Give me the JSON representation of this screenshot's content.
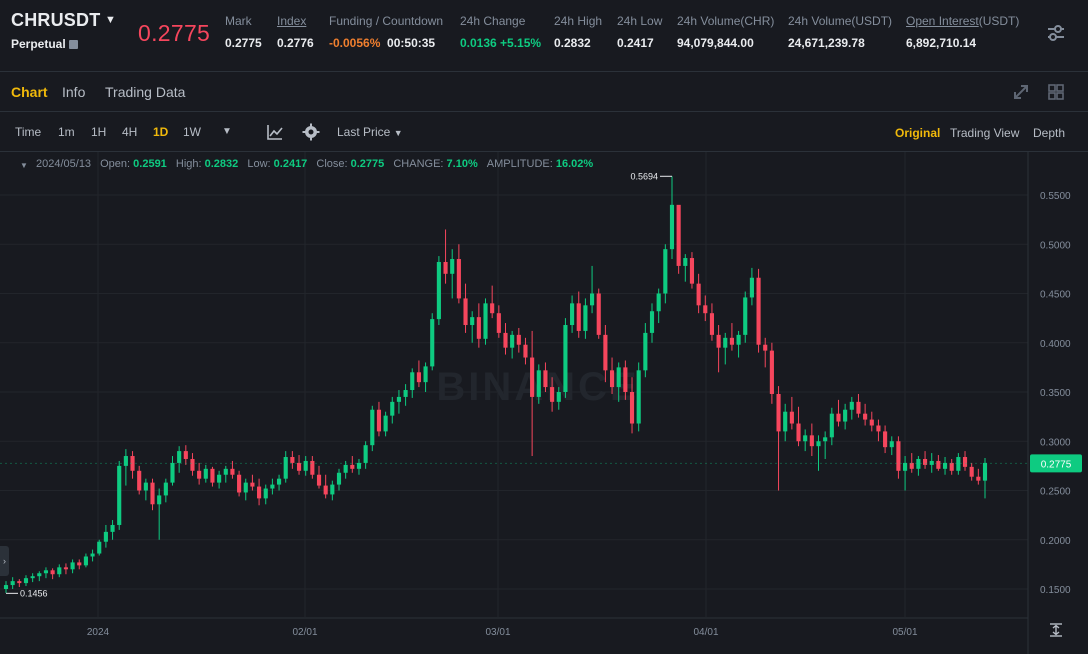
{
  "header": {
    "symbol": "CHRUSDT",
    "contract_type": "Perpetual",
    "last_price": "0.2775",
    "stats": [
      {
        "label": "Mark",
        "value": "0.2775",
        "underline": false
      },
      {
        "label": "Index",
        "value": "0.2776",
        "underline": true
      },
      {
        "label": "Funding / Countdown",
        "value": "-0.0056%",
        "value2": "00:50:35",
        "underline": false
      },
      {
        "label": "24h Change",
        "value": "0.0136 +5.15%",
        "underline": false
      },
      {
        "label": "24h High",
        "value": "0.2832",
        "underline": false
      },
      {
        "label": "24h Low",
        "value": "0.2417",
        "underline": false
      },
      {
        "label": "24h Volume(CHR)",
        "value": "94,079,844.00",
        "underline": false
      },
      {
        "label": "24h Volume(USDT)",
        "value": "24,671,239.78",
        "underline": false
      },
      {
        "label_underlined": "Open Interest",
        "label_suffix": "(USDT)",
        "value": "6,892,710.14"
      }
    ],
    "settings_icon": "sliders-icon"
  },
  "tabs": [
    "Chart",
    "Info",
    "Trading Data"
  ],
  "active_tab": "Chart",
  "toolbar": {
    "intervals": [
      "Time",
      "1m",
      "1H",
      "4H",
      "1D",
      "1W"
    ],
    "active_interval": "1D",
    "price_type": "Last Price",
    "views": [
      "Original",
      "Trading View",
      "Depth"
    ],
    "active_view": "Original"
  },
  "ohlc": {
    "date": "2024/05/13",
    "open_label": "Open:",
    "open": "0.2591",
    "high_label": "High:",
    "high": "0.2832",
    "low_label": "Low:",
    "low": "0.2417",
    "close_label": "Close:",
    "close": "0.2775",
    "change_label": "CHANGE:",
    "change": "7.10%",
    "amplitude_label": "AMPLITUDE:",
    "amplitude": "16.02%"
  },
  "colors": {
    "up": "#0ecb81",
    "down": "#f6465d",
    "accent": "#f0b90b",
    "bg": "#181a20"
  },
  "chart_data": {
    "type": "candlestick",
    "watermark": "BINANCE",
    "y_ticks": [
      "0.5500",
      "0.5000",
      "0.4500",
      "0.4000",
      "0.3500",
      "0.3000",
      "0.2500",
      "0.2000",
      "0.1500"
    ],
    "y_tick_values": [
      0.55,
      0.5,
      0.45,
      0.4,
      0.35,
      0.3,
      0.25,
      0.2,
      0.15
    ],
    "x_ticks": [
      "2024",
      "02/01",
      "03/01",
      "04/01",
      "05/01"
    ],
    "ylim": [
      0.11,
      0.59
    ],
    "current_price": "0.2775",
    "high_marker": "0.5694",
    "low_marker": "0.1456",
    "grid": true,
    "ohlc": [
      [
        0.15,
        0.158,
        0.146,
        0.154
      ],
      [
        0.154,
        0.162,
        0.15,
        0.158
      ],
      [
        0.158,
        0.16,
        0.152,
        0.156
      ],
      [
        0.156,
        0.164,
        0.153,
        0.161
      ],
      [
        0.161,
        0.166,
        0.157,
        0.163
      ],
      [
        0.163,
        0.168,
        0.158,
        0.166
      ],
      [
        0.166,
        0.172,
        0.161,
        0.169
      ],
      [
        0.169,
        0.171,
        0.16,
        0.165
      ],
      [
        0.165,
        0.175,
        0.162,
        0.172
      ],
      [
        0.172,
        0.176,
        0.165,
        0.17
      ],
      [
        0.17,
        0.18,
        0.166,
        0.177
      ],
      [
        0.177,
        0.18,
        0.17,
        0.174
      ],
      [
        0.174,
        0.186,
        0.172,
        0.183
      ],
      [
        0.183,
        0.19,
        0.178,
        0.186
      ],
      [
        0.186,
        0.2,
        0.184,
        0.198
      ],
      [
        0.198,
        0.215,
        0.192,
        0.208
      ],
      [
        0.208,
        0.22,
        0.2,
        0.215
      ],
      [
        0.215,
        0.28,
        0.21,
        0.275
      ],
      [
        0.275,
        0.292,
        0.255,
        0.285
      ],
      [
        0.285,
        0.29,
        0.262,
        0.27
      ],
      [
        0.27,
        0.275,
        0.246,
        0.25
      ],
      [
        0.25,
        0.262,
        0.24,
        0.258
      ],
      [
        0.258,
        0.262,
        0.23,
        0.236
      ],
      [
        0.236,
        0.252,
        0.2,
        0.245
      ],
      [
        0.245,
        0.262,
        0.238,
        0.258
      ],
      [
        0.258,
        0.285,
        0.255,
        0.278
      ],
      [
        0.278,
        0.295,
        0.268,
        0.29
      ],
      [
        0.29,
        0.296,
        0.276,
        0.282
      ],
      [
        0.282,
        0.288,
        0.265,
        0.27
      ],
      [
        0.27,
        0.278,
        0.256,
        0.262
      ],
      [
        0.262,
        0.276,
        0.258,
        0.272
      ],
      [
        0.272,
        0.274,
        0.254,
        0.258
      ],
      [
        0.258,
        0.27,
        0.252,
        0.266
      ],
      [
        0.266,
        0.275,
        0.258,
        0.272
      ],
      [
        0.272,
        0.28,
        0.262,
        0.266
      ],
      [
        0.266,
        0.27,
        0.244,
        0.248
      ],
      [
        0.248,
        0.262,
        0.24,
        0.258
      ],
      [
        0.258,
        0.266,
        0.25,
        0.254
      ],
      [
        0.254,
        0.262,
        0.235,
        0.242
      ],
      [
        0.242,
        0.256,
        0.236,
        0.252
      ],
      [
        0.252,
        0.262,
        0.246,
        0.256
      ],
      [
        0.256,
        0.266,
        0.25,
        0.262
      ],
      [
        0.262,
        0.29,
        0.258,
        0.284
      ],
      [
        0.284,
        0.29,
        0.272,
        0.278
      ],
      [
        0.278,
        0.286,
        0.266,
        0.27
      ],
      [
        0.27,
        0.285,
        0.265,
        0.28
      ],
      [
        0.28,
        0.285,
        0.262,
        0.266
      ],
      [
        0.266,
        0.275,
        0.252,
        0.255
      ],
      [
        0.255,
        0.266,
        0.242,
        0.246
      ],
      [
        0.246,
        0.26,
        0.24,
        0.256
      ],
      [
        0.256,
        0.272,
        0.25,
        0.268
      ],
      [
        0.268,
        0.28,
        0.262,
        0.276
      ],
      [
        0.276,
        0.285,
        0.268,
        0.272
      ],
      [
        0.272,
        0.282,
        0.266,
        0.278
      ],
      [
        0.278,
        0.3,
        0.272,
        0.296
      ],
      [
        0.296,
        0.336,
        0.29,
        0.332
      ],
      [
        0.332,
        0.34,
        0.305,
        0.31
      ],
      [
        0.31,
        0.33,
        0.305,
        0.326
      ],
      [
        0.326,
        0.345,
        0.318,
        0.34
      ],
      [
        0.34,
        0.352,
        0.328,
        0.345
      ],
      [
        0.345,
        0.358,
        0.336,
        0.352
      ],
      [
        0.352,
        0.374,
        0.344,
        0.37
      ],
      [
        0.37,
        0.382,
        0.355,
        0.36
      ],
      [
        0.36,
        0.38,
        0.35,
        0.376
      ],
      [
        0.376,
        0.43,
        0.372,
        0.424
      ],
      [
        0.424,
        0.488,
        0.418,
        0.482
      ],
      [
        0.482,
        0.515,
        0.46,
        0.47
      ],
      [
        0.47,
        0.495,
        0.445,
        0.485
      ],
      [
        0.485,
        0.5,
        0.44,
        0.445
      ],
      [
        0.445,
        0.46,
        0.41,
        0.418
      ],
      [
        0.418,
        0.432,
        0.4,
        0.426
      ],
      [
        0.426,
        0.44,
        0.395,
        0.404
      ],
      [
        0.404,
        0.445,
        0.398,
        0.44
      ],
      [
        0.44,
        0.458,
        0.425,
        0.43
      ],
      [
        0.43,
        0.438,
        0.405,
        0.41
      ],
      [
        0.41,
        0.42,
        0.388,
        0.395
      ],
      [
        0.395,
        0.412,
        0.384,
        0.408
      ],
      [
        0.408,
        0.415,
        0.39,
        0.398
      ],
      [
        0.398,
        0.405,
        0.378,
        0.385
      ],
      [
        0.385,
        0.412,
        0.285,
        0.345
      ],
      [
        0.345,
        0.378,
        0.338,
        0.372
      ],
      [
        0.372,
        0.38,
        0.35,
        0.355
      ],
      [
        0.355,
        0.365,
        0.33,
        0.34
      ],
      [
        0.34,
        0.355,
        0.332,
        0.35
      ],
      [
        0.35,
        0.425,
        0.344,
        0.418
      ],
      [
        0.418,
        0.448,
        0.41,
        0.44
      ],
      [
        0.44,
        0.452,
        0.405,
        0.412
      ],
      [
        0.412,
        0.445,
        0.404,
        0.438
      ],
      [
        0.438,
        0.478,
        0.43,
        0.45
      ],
      [
        0.45,
        0.455,
        0.404,
        0.408
      ],
      [
        0.408,
        0.418,
        0.36,
        0.372
      ],
      [
        0.372,
        0.385,
        0.348,
        0.355
      ],
      [
        0.355,
        0.38,
        0.34,
        0.375
      ],
      [
        0.375,
        0.382,
        0.342,
        0.35
      ],
      [
        0.35,
        0.365,
        0.308,
        0.318
      ],
      [
        0.318,
        0.38,
        0.31,
        0.372
      ],
      [
        0.372,
        0.42,
        0.365,
        0.41
      ],
      [
        0.41,
        0.44,
        0.4,
        0.432
      ],
      [
        0.432,
        0.455,
        0.42,
        0.45
      ],
      [
        0.45,
        0.5,
        0.44,
        0.495
      ],
      [
        0.495,
        0.569,
        0.485,
        0.54
      ],
      [
        0.54,
        0.505,
        0.47,
        0.478
      ],
      [
        0.478,
        0.49,
        0.462,
        0.486
      ],
      [
        0.486,
        0.492,
        0.455,
        0.46
      ],
      [
        0.46,
        0.47,
        0.43,
        0.438
      ],
      [
        0.438,
        0.448,
        0.422,
        0.43
      ],
      [
        0.43,
        0.44,
        0.402,
        0.408
      ],
      [
        0.408,
        0.418,
        0.37,
        0.395
      ],
      [
        0.395,
        0.41,
        0.378,
        0.405
      ],
      [
        0.405,
        0.42,
        0.392,
        0.398
      ],
      [
        0.398,
        0.412,
        0.385,
        0.408
      ],
      [
        0.408,
        0.452,
        0.4,
        0.446
      ],
      [
        0.446,
        0.476,
        0.438,
        0.466
      ],
      [
        0.466,
        0.475,
        0.39,
        0.398
      ],
      [
        0.398,
        0.405,
        0.375,
        0.392
      ],
      [
        0.392,
        0.4,
        0.338,
        0.348
      ],
      [
        0.348,
        0.356,
        0.25,
        0.31
      ],
      [
        0.31,
        0.338,
        0.3,
        0.33
      ],
      [
        0.33,
        0.345,
        0.312,
        0.318
      ],
      [
        0.318,
        0.335,
        0.295,
        0.3
      ],
      [
        0.3,
        0.312,
        0.29,
        0.306
      ],
      [
        0.306,
        0.318,
        0.285,
        0.295
      ],
      [
        0.295,
        0.306,
        0.27,
        0.3
      ],
      [
        0.3,
        0.31,
        0.282,
        0.304
      ],
      [
        0.304,
        0.334,
        0.296,
        0.328
      ],
      [
        0.328,
        0.342,
        0.315,
        0.32
      ],
      [
        0.32,
        0.338,
        0.312,
        0.332
      ],
      [
        0.332,
        0.345,
        0.322,
        0.34
      ],
      [
        0.34,
        0.348,
        0.324,
        0.328
      ],
      [
        0.328,
        0.338,
        0.316,
        0.322
      ],
      [
        0.322,
        0.33,
        0.31,
        0.316
      ],
      [
        0.316,
        0.322,
        0.3,
        0.31
      ],
      [
        0.31,
        0.316,
        0.288,
        0.294
      ],
      [
        0.294,
        0.305,
        0.286,
        0.3
      ],
      [
        0.3,
        0.305,
        0.262,
        0.27
      ],
      [
        0.27,
        0.285,
        0.25,
        0.278
      ],
      [
        0.278,
        0.288,
        0.268,
        0.272
      ],
      [
        0.272,
        0.285,
        0.265,
        0.282
      ],
      [
        0.282,
        0.29,
        0.272,
        0.276
      ],
      [
        0.276,
        0.288,
        0.268,
        0.28
      ],
      [
        0.28,
        0.286,
        0.27,
        0.272
      ],
      [
        0.272,
        0.284,
        0.266,
        0.278
      ],
      [
        0.278,
        0.282,
        0.266,
        0.27
      ],
      [
        0.27,
        0.288,
        0.266,
        0.284
      ],
      [
        0.284,
        0.29,
        0.27,
        0.274
      ],
      [
        0.274,
        0.278,
        0.26,
        0.264
      ],
      [
        0.264,
        0.272,
        0.256,
        0.26
      ],
      [
        0.26,
        0.283,
        0.242,
        0.278
      ]
    ]
  }
}
